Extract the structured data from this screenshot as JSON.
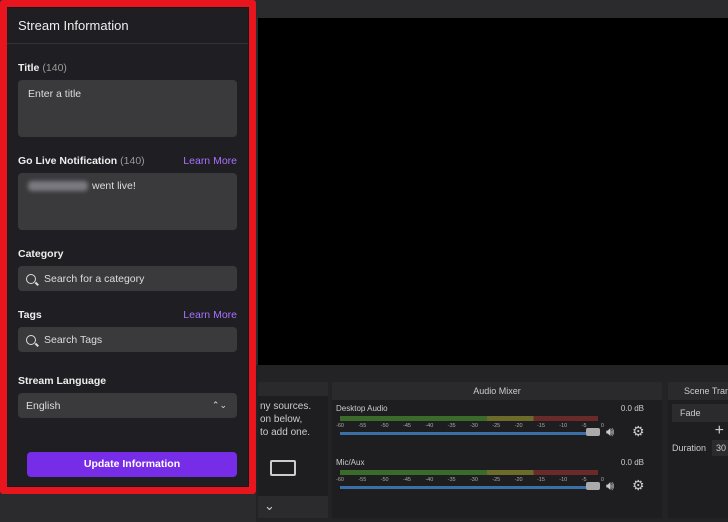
{
  "stream_info": {
    "heading": "Stream Information",
    "title_label": "Title",
    "title_count": "(140)",
    "title_placeholder": "Enter a title",
    "notif_label": "Go Live Notification",
    "notif_count": "(140)",
    "notif_learn": "Learn More",
    "notif_value": "went live!",
    "category_label": "Category",
    "category_placeholder": "Search for a category",
    "tags_label": "Tags",
    "tags_learn": "Learn More",
    "tags_placeholder": "Search Tags",
    "language_label": "Stream Language",
    "language_value": "English",
    "update_button": "Update Information"
  },
  "sources": {
    "hint_lines": [
      "ny sources.",
      "on below,",
      "to add one."
    ]
  },
  "mixer": {
    "title": "Audio Mixer",
    "ticks": [
      "-60",
      "-55",
      "-50",
      "-45",
      "-40",
      "-35",
      "-30",
      "-25",
      "-20",
      "-15",
      "-10",
      "-5",
      "0"
    ],
    "channels": [
      {
        "name": "Desktop Audio",
        "level": "0.0 dB"
      },
      {
        "name": "Mic/Aux",
        "level": "0.0 dB"
      }
    ]
  },
  "transitions": {
    "title": "Scene Transitions",
    "selected": "Fade",
    "duration_label": "Duration",
    "duration_value": "30"
  },
  "colors": {
    "accent": "#772ce8",
    "link": "#a970ff",
    "highlight_border": "#e8151f"
  }
}
